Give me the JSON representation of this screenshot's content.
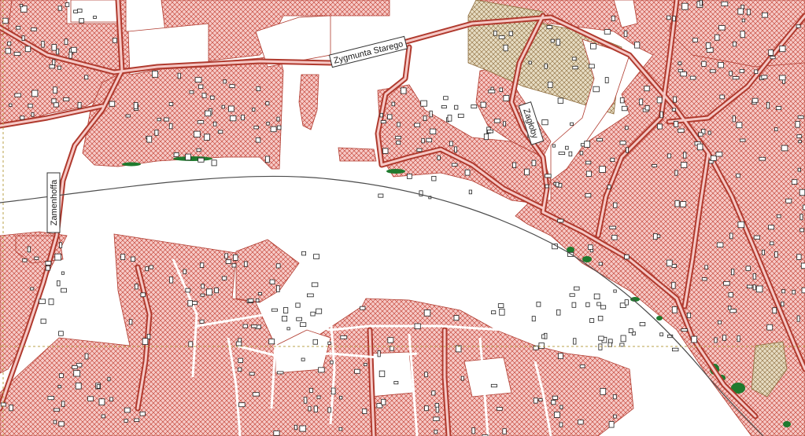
{
  "map": {
    "colors": {
      "background": "#ffffff",
      "built_area_fill": "#f6c9c6",
      "built_area_hatch": "#c0392b",
      "built_area_outline": "#b03a2e",
      "green_area": "#1f7a2e",
      "agricultural_fill": "#e6dcc2",
      "agricultural_hatch": "#8c6a3a",
      "river_line": "#4d4d4d",
      "grid_line": "#b8a24a",
      "building_outline": "#222222"
    },
    "legend_layers": [
      "built-up area",
      "buildings",
      "green areas",
      "agricultural land",
      "roads",
      "river bank"
    ],
    "streets": {
      "zygmunta_starego": "Zygmunta Starego",
      "zamenhoffa": "Zamenhoffa",
      "zagloby": "Zagłoby"
    }
  }
}
